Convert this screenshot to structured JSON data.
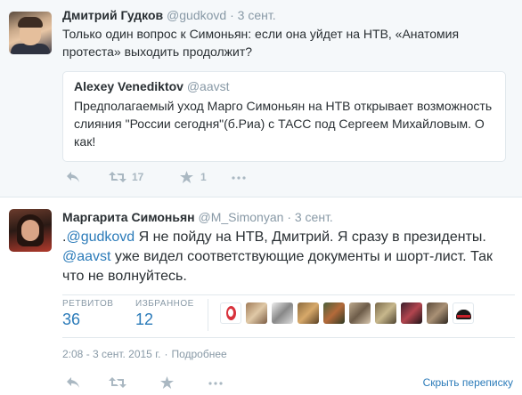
{
  "reply_context_tweet": {
    "fullname": "Дмитрий Гудков",
    "username": "@gudkovd",
    "date": "3 сент.",
    "text": "Только один вопрос к Симоньян: если она уйдет на НТВ, «Анатомия протеста» выходить продолжит?",
    "quoted": {
      "fullname": "Alexey Venediktov",
      "username": "@aavst",
      "text": "Предполагаемый уход Марго Симоньян на НТВ открывает возможность слияния \"России сегодня\"(б.Риа) с ТАСС под Сергеем Михайловым. О как!"
    },
    "actions": {
      "reply_icon": "reply-icon",
      "retweet_icon": "retweet-icon",
      "retweet_count": "17",
      "favorite_icon": "star-icon",
      "favorite_count": "1",
      "more_icon": "more-icon"
    }
  },
  "main_tweet": {
    "fullname": "Маргарита Симоньян",
    "username": "@M_Simonyan",
    "date": "3 сент.",
    "text_prefix": ".",
    "mention1": "@gudkovd",
    "text_part1": " Я не пойду на НТВ, Дмитрий. Я сразу в президенты. ",
    "mention2": "@aavst",
    "text_part2": " уже видел соответствующие документы и шорт-лист. Так что не волнуйтесь.",
    "stats": {
      "retweets_label": "РЕТВИТОВ",
      "retweets_value": "36",
      "favorites_label": "ИЗБРАННОЕ",
      "favorites_value": "12"
    },
    "timestamp": "2:08 - 3 сент. 2015 г.",
    "details_link": "Подробнее",
    "collapse_link": "Скрыть переписку",
    "colors": {
      "link": "#2b7bb9",
      "muted": "#8899a6",
      "action_icon": "#aab8c2",
      "context_bg": "#f5f8fa"
    }
  }
}
